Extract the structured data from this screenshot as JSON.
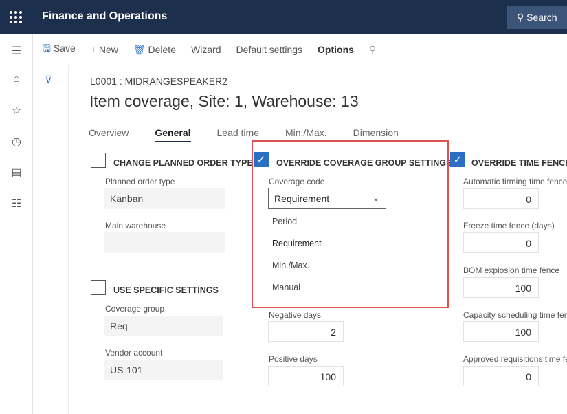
{
  "header": {
    "app_title": "Finance and Operations",
    "search_label": "Search"
  },
  "toolbar": {
    "save": "Save",
    "new": "New",
    "delete": "Delete",
    "wizard": "Wizard",
    "default_settings": "Default settings",
    "options": "Options"
  },
  "page": {
    "breadcrumb": "L0001 : MIDRANGESPEAKER2",
    "title": "Item coverage, Site: 1, Warehouse: 13"
  },
  "tabs": [
    {
      "label": "Overview"
    },
    {
      "label": "General",
      "active": true
    },
    {
      "label": "Lead time"
    },
    {
      "label": "Min./Max."
    },
    {
      "label": "Dimension"
    }
  ],
  "left": {
    "change_planned_order_type": {
      "label": "CHANGE PLANNED ORDER TYPE",
      "checked": false
    },
    "planned_order_type_label": "Planned order type",
    "planned_order_type": "Kanban",
    "main_warehouse_label": "Main warehouse",
    "main_warehouse": "",
    "use_specific_settings": {
      "label": "USE SPECIFIC SETTINGS",
      "checked": false
    },
    "coverage_group_label": "Coverage group",
    "coverage_group": "Req",
    "vendor_account_label": "Vendor account",
    "vendor_account": "US-101"
  },
  "middle": {
    "override_coverage": {
      "label": "OVERRIDE COVERAGE GROUP SETTINGS",
      "checked": true
    },
    "coverage_code_label": "Coverage code",
    "coverage_code": "Requirement",
    "coverage_options": [
      "Period",
      "Requirement",
      "Min./Max.",
      "Manual"
    ],
    "negative_days_label": "Negative days",
    "negative_days": "2",
    "positive_days_label": "Positive days",
    "positive_days": "100"
  },
  "right": {
    "override_time_fences": {
      "label": "OVERRIDE TIME FENCES",
      "checked": true
    },
    "fields": [
      {
        "label": "Automatic firming time fence",
        "value": "0"
      },
      {
        "label": "Freeze time fence (days)",
        "value": "0"
      },
      {
        "label": "BOM explosion time fence",
        "value": "100"
      },
      {
        "label": "Capacity scheduling time fence",
        "value": "100"
      },
      {
        "label": "Approved requisitions time fence",
        "value": "0"
      }
    ]
  },
  "colors": {
    "header": "#1c2f4d",
    "accent": "#2b6fc4",
    "highlight_box": "#e05050"
  }
}
